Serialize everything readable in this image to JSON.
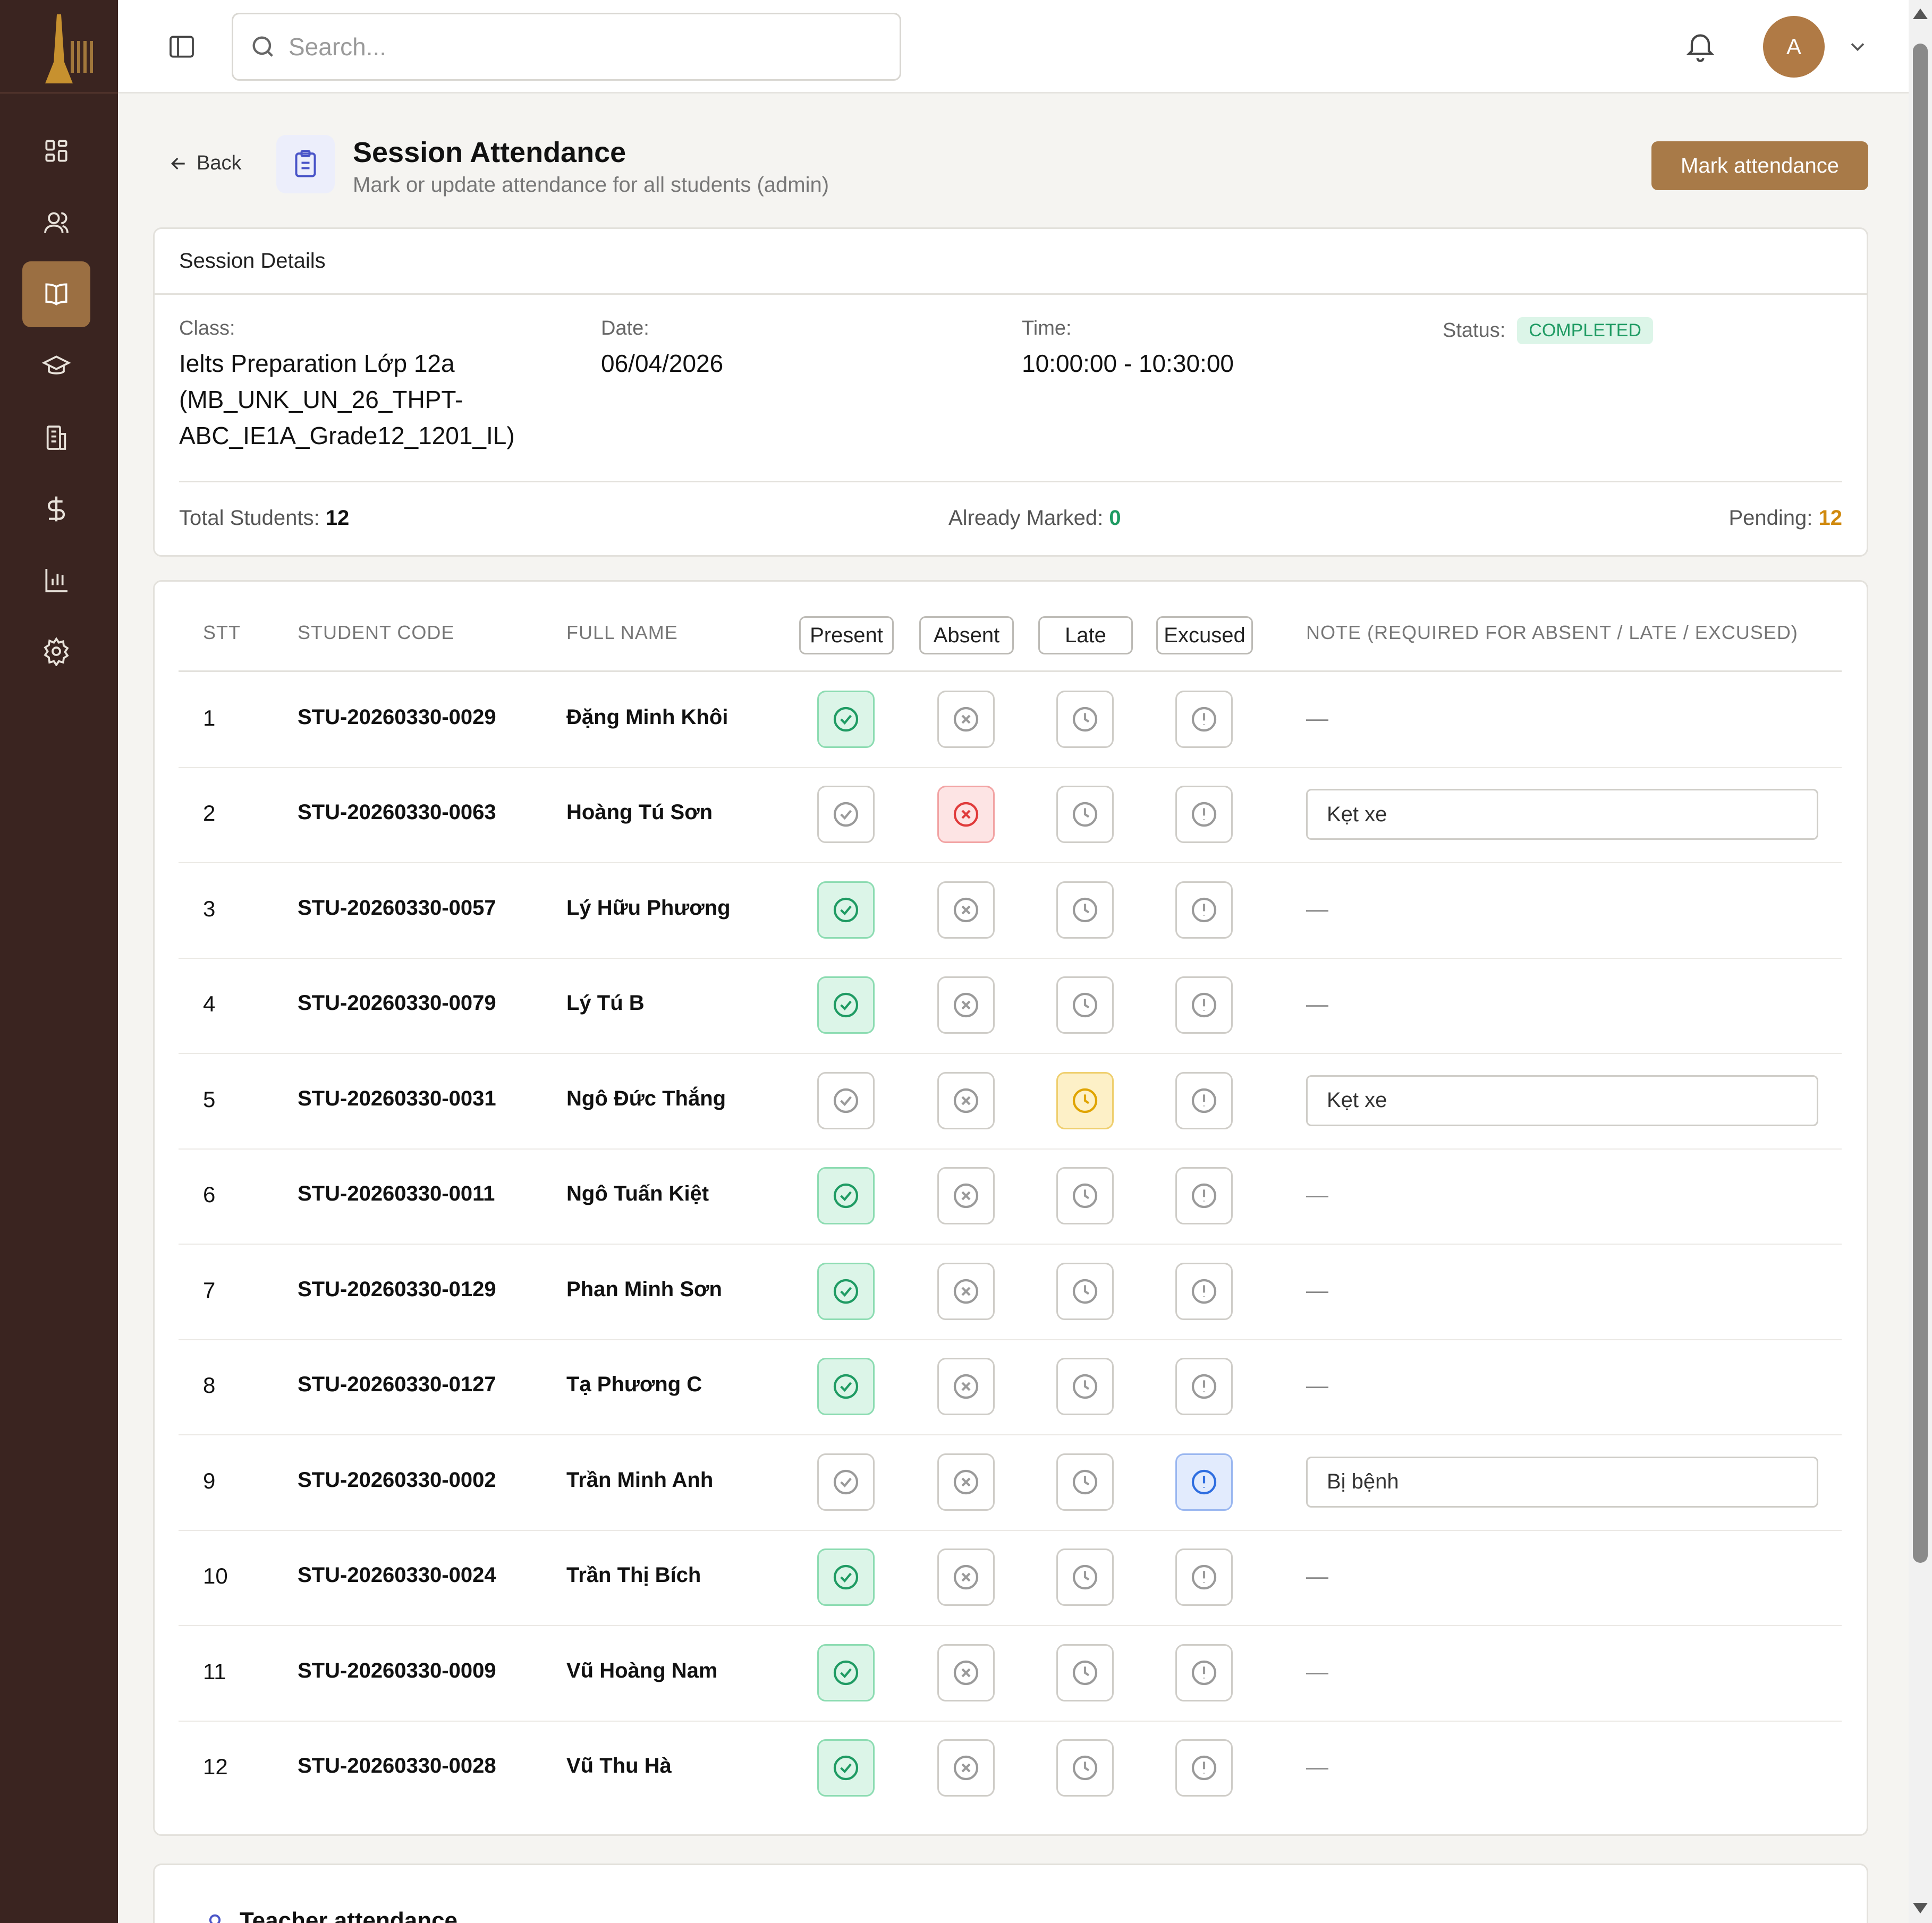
{
  "search": {
    "placeholder": "Search..."
  },
  "user": {
    "avatar_initial": "A"
  },
  "colors": {
    "sidebar": "#3a2420",
    "accent": "#a87a48",
    "present": "#1f9b63",
    "absent": "#e03b3b",
    "late": "#e0a400",
    "excused": "#2f6ee0"
  },
  "sidebar": {
    "items": [
      {
        "name": "dashboard-icon",
        "active": false
      },
      {
        "name": "users-icon",
        "active": false
      },
      {
        "name": "book-icon",
        "active": true
      },
      {
        "name": "graduation-cap-icon",
        "active": false
      },
      {
        "name": "building-icon",
        "active": false
      },
      {
        "name": "dollar-icon",
        "active": false
      },
      {
        "name": "chart-icon",
        "active": false
      },
      {
        "name": "settings-icon",
        "active": false
      }
    ]
  },
  "header": {
    "back_label": "Back",
    "title": "Session Attendance",
    "subtitle": "Mark or update attendance for all students (admin)",
    "mark_button": "Mark attendance"
  },
  "session": {
    "card_title": "Session Details",
    "class_label": "Class:",
    "class_value": "Ielts Preparation Lớp 12a (MB_UNK_UN_26_THPT-ABC_IE1A_Grade12_1201_IL)",
    "date_label": "Date:",
    "date_value": "06/04/2026",
    "time_label": "Time:",
    "time_value": "10:00:00 - 10:30:00",
    "status_label": "Status:",
    "status_value": "COMPLETED",
    "total_label": "Total Students:",
    "total_value": "12",
    "marked_label": "Already Marked:",
    "marked_value": "0",
    "pending_label": "Pending:",
    "pending_value": "12"
  },
  "table": {
    "columns": {
      "stt": "STT",
      "code": "STUDENT CODE",
      "name": "FULL NAME",
      "present": "Present",
      "absent": "Absent",
      "late": "Late",
      "excused": "Excused",
      "note": "NOTE (REQUIRED FOR ABSENT / LATE / EXCUSED)"
    },
    "empty_note": "—",
    "rows": [
      {
        "stt": "1",
        "code": "STU-20260330-0029",
        "name": "Đặng Minh Khôi",
        "status": "present",
        "note": ""
      },
      {
        "stt": "2",
        "code": "STU-20260330-0063",
        "name": "Hoàng Tú Sơn",
        "status": "absent",
        "note": "Kẹt xe"
      },
      {
        "stt": "3",
        "code": "STU-20260330-0057",
        "name": "Lý Hữu Phương",
        "status": "present",
        "note": ""
      },
      {
        "stt": "4",
        "code": "STU-20260330-0079",
        "name": "Lý Tú B",
        "status": "present",
        "note": ""
      },
      {
        "stt": "5",
        "code": "STU-20260330-0031",
        "name": "Ngô Đức Thắng",
        "status": "late",
        "note": "Kẹt xe"
      },
      {
        "stt": "6",
        "code": "STU-20260330-0011",
        "name": "Ngô Tuấn Kiệt",
        "status": "present",
        "note": ""
      },
      {
        "stt": "7",
        "code": "STU-20260330-0129",
        "name": "Phan Minh Sơn",
        "status": "present",
        "note": ""
      },
      {
        "stt": "8",
        "code": "STU-20260330-0127",
        "name": "Tạ Phương C",
        "status": "present",
        "note": ""
      },
      {
        "stt": "9",
        "code": "STU-20260330-0002",
        "name": "Trần Minh Anh",
        "status": "excused",
        "note": "Bị bệnh"
      },
      {
        "stt": "10",
        "code": "STU-20260330-0024",
        "name": "Trần Thị Bích",
        "status": "present",
        "note": ""
      },
      {
        "stt": "11",
        "code": "STU-20260330-0009",
        "name": "Vũ Hoàng Nam",
        "status": "present",
        "note": ""
      },
      {
        "stt": "12",
        "code": "STU-20260330-0028",
        "name": "Vũ Thu Hà",
        "status": "present",
        "note": ""
      }
    ]
  },
  "teacher": {
    "title": "Teacher attendance"
  }
}
